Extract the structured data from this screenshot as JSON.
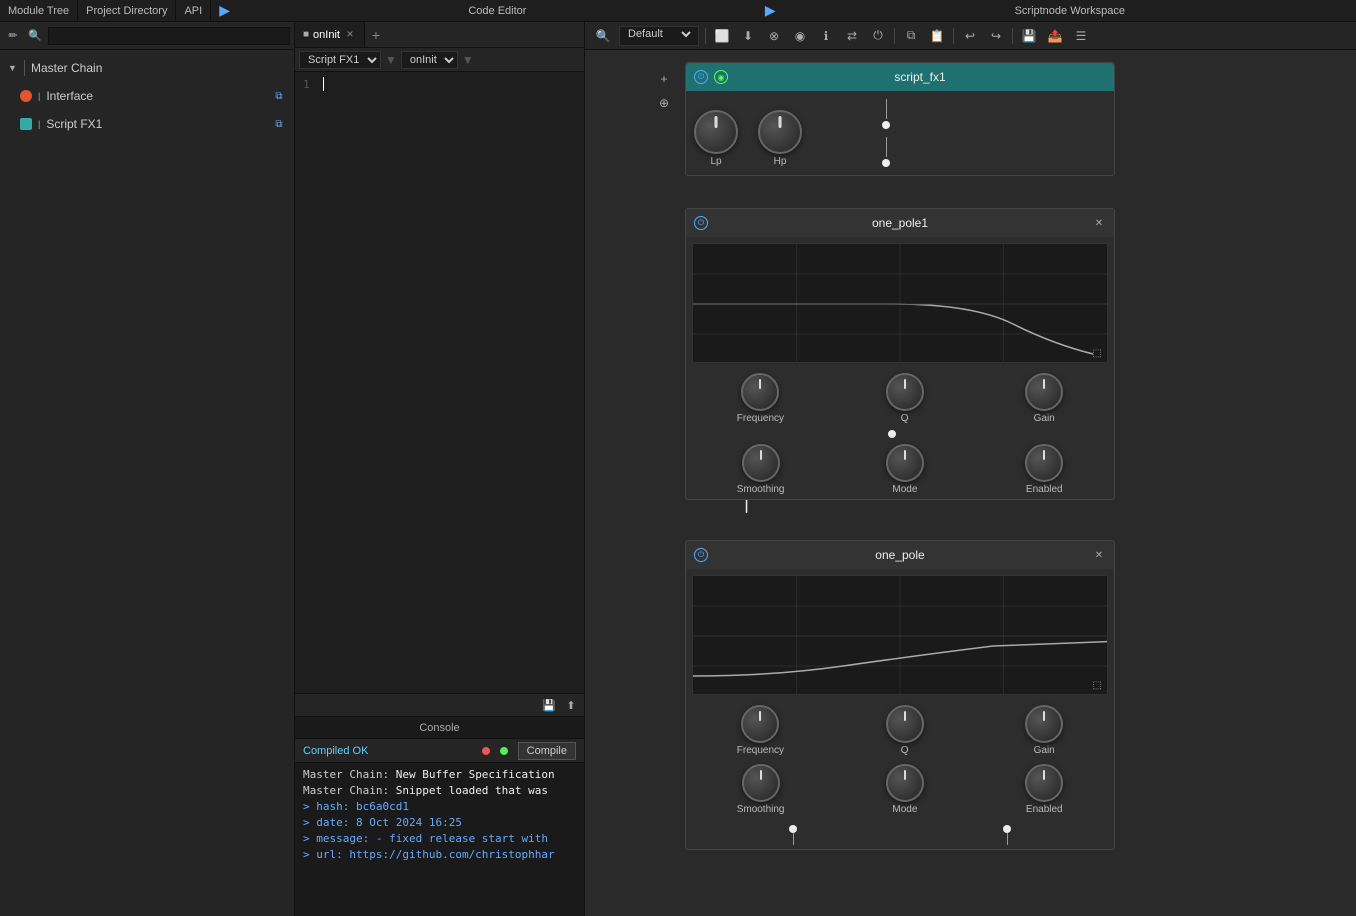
{
  "app": {
    "title": "Scriptnode Workspace"
  },
  "tabs": {
    "module_tree": "Module Tree",
    "project_directory": "Project Directory",
    "api": "API"
  },
  "left_panel": {
    "search_placeholder": "",
    "master_chain": "Master Chain",
    "interface_item": "Interface",
    "script_fx1_item": "Script FX1"
  },
  "code_editor": {
    "title": "Code Editor",
    "tab_label": "onInit",
    "script_selector": "Script FX1",
    "method_selector": "onInit",
    "line_number": "1"
  },
  "console": {
    "title": "Console",
    "compiled_ok": "Compiled OK",
    "compile_btn": "Compile",
    "lines": [
      {
        "text": "Master Chain: New Buffer Specification",
        "style": "normal"
      },
      {
        "text": "Master Chain: Snippet loaded that was",
        "style": "normal"
      },
      {
        "text": "> hash: bc6a0cd1",
        "style": "blue"
      },
      {
        "text": "> date: 8 Oct 2024 16:25",
        "style": "blue"
      },
      {
        "text": "> message: - fixed release start with",
        "style": "blue"
      },
      {
        "text": "> url: https://github.com/christophhar",
        "style": "blue"
      }
    ]
  },
  "workspace": {
    "title": "Scriptnode Workspace",
    "script_fx1_title": "script_fx1",
    "one_pole1_title": "one_pole1",
    "one_pole2_title": "one_pole",
    "knobs": {
      "lp": "Lp",
      "hp": "Hp",
      "frequency": "Frequency",
      "q": "Q",
      "gain": "Gain",
      "smoothing": "Smoothing",
      "mode": "Mode",
      "enabled": "Enabled"
    }
  }
}
